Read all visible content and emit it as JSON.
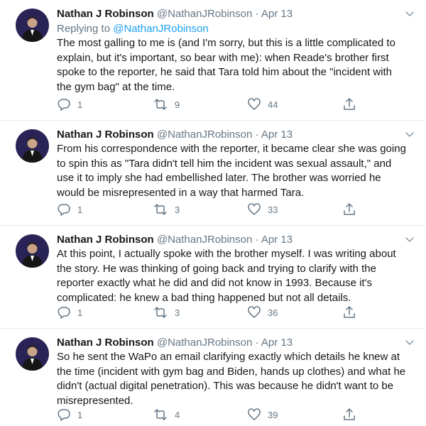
{
  "tweets": [
    {
      "name": "Nathan J Robinson",
      "handle": "@NathanJRobinson",
      "dot": "·",
      "date": "Apr 13",
      "replying_prefix": "Replying to",
      "replying_handle": "@NathanJRobinson",
      "lines": [
        "The most galling to me is (and I'm sorry, but this is a little complicated to",
        "explain, but it's important, so bear with me): when Reade's brother first",
        "spoke to the reporter, he said that Tara told him about the \"incident with",
        "the gym bag\" at the time."
      ],
      "replies": "1",
      "retweets": "9",
      "likes": "44"
    },
    {
      "name": "Nathan J Robinson",
      "handle": "@NathanJRobinson",
      "dot": "·",
      "date": "Apr 13",
      "lines": [
        "From his correspondence with the reporter, it became clear she was going",
        "to spin this as \"Tara didn't tell him the incident was sexual assault,\" and",
        "use it to imply she had embellished later. The brother was worried he",
        "would be misrepresented in a way that harmed Tara."
      ],
      "replies": "1",
      "retweets": "3",
      "likes": "33"
    },
    {
      "name": "Nathan J Robinson",
      "handle": "@NathanJRobinson",
      "dot": "·",
      "date": "Apr 13",
      "lines": [
        "At this point, I actually spoke with the brother myself. I was writing about",
        "the story. He was thinking of going back and trying to clarify with the",
        "reporter exactly what he did and did not know in 1993. Because it's",
        "complicated: he knew a bad thing happened but not all details."
      ],
      "replies": "1",
      "retweets": "3",
      "likes": "36"
    },
    {
      "name": "Nathan J Robinson",
      "handle": "@NathanJRobinson",
      "dot": "·",
      "date": "Apr 13",
      "lines": [
        "So he sent the WaPo an email clarifying exactly which details he knew at",
        "the time (incident with gym bag and Biden, hands up clothes) and what he",
        "didn't (actual digital penetration). This was because he didn't want to be",
        "misrepresented."
      ],
      "replies": "1",
      "retweets": "4",
      "likes": "39"
    }
  ],
  "colors": {
    "text": "#14171a",
    "secondary": "#657786",
    "link": "#1da1f2",
    "divider": "#e6ecf0"
  },
  "icons": [
    "avatar",
    "chevron-down-icon",
    "reply-icon",
    "retweet-icon",
    "like-icon",
    "share-icon"
  ]
}
